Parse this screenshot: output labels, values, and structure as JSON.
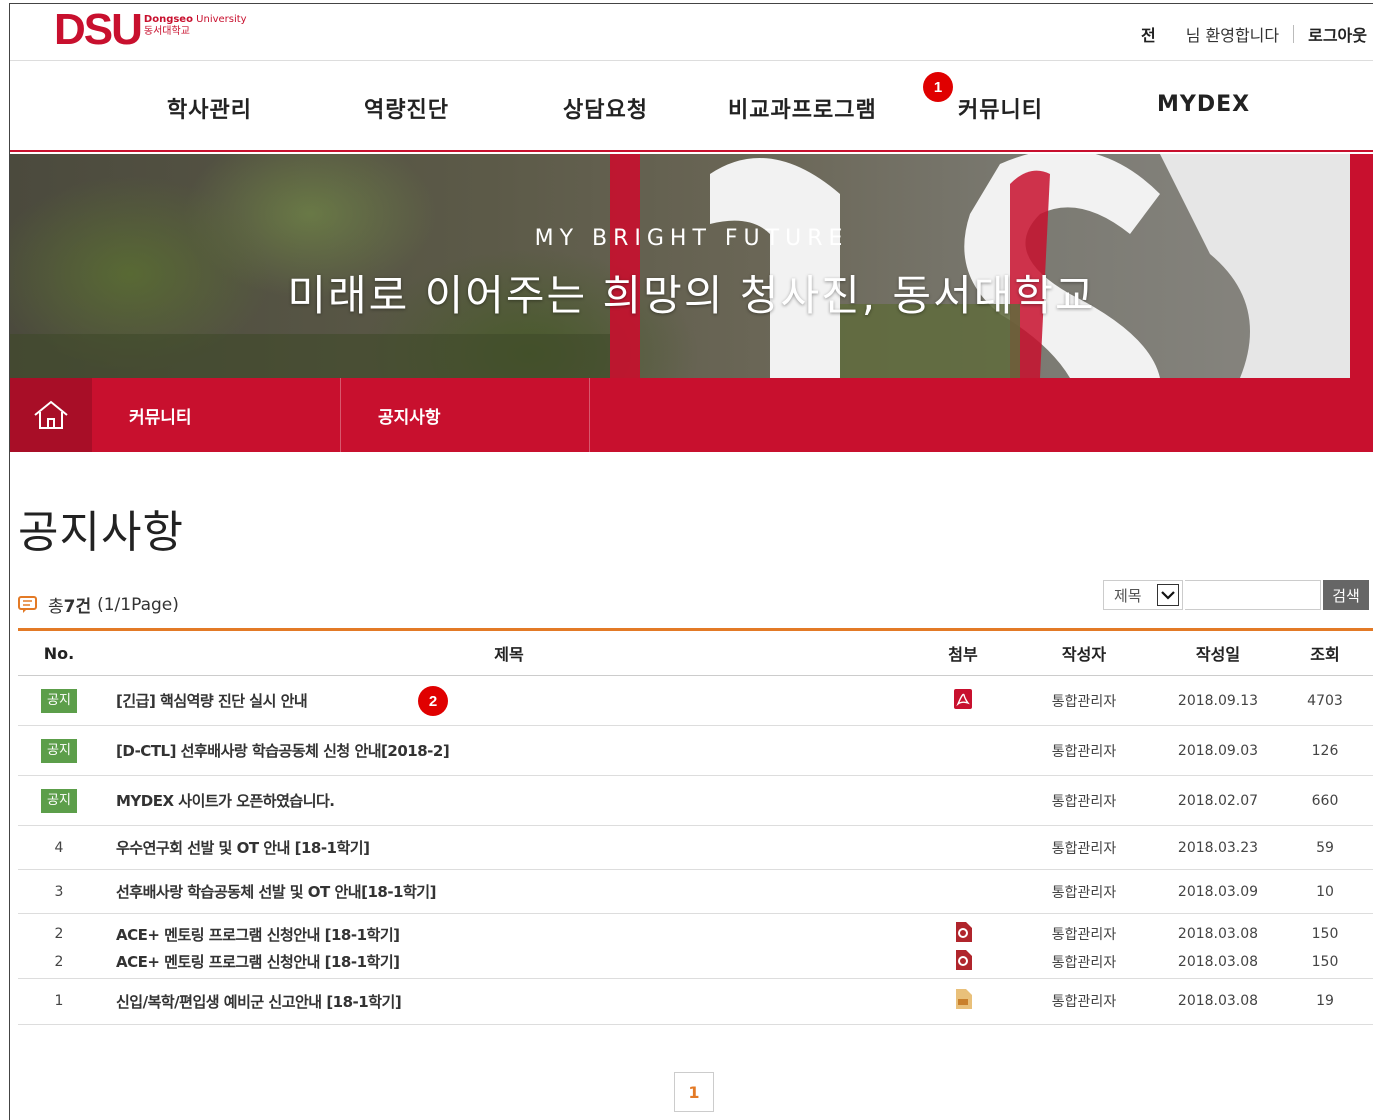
{
  "header": {
    "logo_big": "DSU",
    "logo_en_bold": "Dongseo",
    "logo_en": "University",
    "logo_ko": "동서대학교",
    "user_name": "전",
    "welcome": "님 환영합니다",
    "logout": "로그아웃"
  },
  "gnb": [
    "학사관리",
    "역량진단",
    "상담요청",
    "비교과프로그램",
    "커뮤니티",
    "MYDEX"
  ],
  "badges": {
    "first": "1",
    "second": "2"
  },
  "hero": {
    "subtitle": "MY BRIGHT FUTURE",
    "title": "미래로 이어주는 희망의 청사진, 동서대학교"
  },
  "breadcrumb": {
    "home_icon": "home-icon",
    "level1": "커뮤니티",
    "level2": "공지사항"
  },
  "page_title": "공지사항",
  "summary": {
    "prefix": "총",
    "count": "7건",
    "page": "(1/1Page)"
  },
  "search": {
    "select_value": "제목",
    "button": "검색"
  },
  "table": {
    "headers": [
      "No.",
      "제목",
      "첨부",
      "작성자",
      "작성일",
      "조회"
    ],
    "rows": [
      {
        "no": "공지",
        "title": "[긴급] 핵심역량 진단 실시 안내",
        "attach": "pdf",
        "author": "통합관리자",
        "date": "2018.09.13",
        "views": "4703"
      },
      {
        "no": "공지",
        "title": "[D-CTL] 선후배사랑 학습공동체 신청 안내[2018-2]",
        "attach": "",
        "author": "통합관리자",
        "date": "2018.09.03",
        "views": "126"
      },
      {
        "no": "공지",
        "title": "MYDEX 사이트가 오픈하였습니다.",
        "attach": "",
        "author": "통합관리자",
        "date": "2018.02.07",
        "views": "660"
      },
      {
        "no": "4",
        "title": "우수연구회 선발 및 OT 안내 [18-1학기]",
        "attach": "",
        "author": "통합관리자",
        "date": "2018.03.23",
        "views": "59"
      },
      {
        "no": "3",
        "title": "선후배사랑 학습공동체 선발 및 OT 안내[18-1학기]",
        "attach": "",
        "author": "통합관리자",
        "date": "2018.03.09",
        "views": "10"
      },
      {
        "no": "2",
        "title": "ACE+ 멘토링 프로그램 신청안내 [18-1학기]",
        "attach": "hwp",
        "author": "통합관리자",
        "date": "2018.03.08",
        "views": "150"
      },
      {
        "no": "2",
        "title": "ACE+ 멘토링 프로그램 신청안내 [18-1학기]",
        "attach": "hwp",
        "author": "통합관리자",
        "date": "2018.03.08",
        "views": "150"
      },
      {
        "no": "1",
        "title": "신입/복학/편입생 예비군 신고안내 [18-1학기]",
        "attach": "doc",
        "author": "통합관리자",
        "date": "2018.03.08",
        "views": "19"
      }
    ]
  },
  "pagination": {
    "current": "1"
  },
  "colors": {
    "brand": "#c8102e",
    "accent": "#e37a26",
    "notice_tag": "#5c9e4a"
  }
}
